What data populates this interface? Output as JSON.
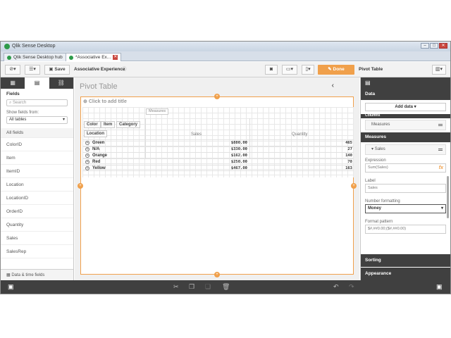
{
  "window": {
    "title": "Qlik Sense Desktop"
  },
  "tabs": [
    {
      "label": "Qlik Sense Desktop hub"
    },
    {
      "label": "*Associative Ex..."
    }
  ],
  "toolbar": {
    "save_label": "Save",
    "app_name": "Associative Experience",
    "done_label": "Done",
    "viz_name": "Pivot Table"
  },
  "left_panel": {
    "title": "Fields",
    "search_placeholder": "Search",
    "show_fields_label": "Show fields from:",
    "tables_select": "All tables",
    "all_fields": "All fields",
    "fields": [
      "ColorID",
      "Item",
      "ItemID",
      "Location",
      "LocationID",
      "OrderID",
      "Quantity",
      "Sales",
      "SalesRep"
    ],
    "footer": "Data & time fields"
  },
  "sheet": {
    "title": "Pivot Table",
    "object_title": "Click to add title",
    "measures_chip": "Measures",
    "dims": [
      "Color",
      "Item",
      "Category",
      "Location"
    ],
    "col_sales": "Sales",
    "col_quantity": "Quantity",
    "rows": [
      {
        "label": "Green",
        "sales": "$880.00",
        "quantity": "465"
      },
      {
        "label": "N/A",
        "sales": "$330.00",
        "quantity": "27"
      },
      {
        "label": "Orange",
        "sales": "$162.00",
        "quantity": "140"
      },
      {
        "label": "Red",
        "sales": "$250.00",
        "quantity": "78"
      },
      {
        "label": "Yellow",
        "sales": "$467.00",
        "quantity": "163"
      }
    ]
  },
  "right_panel": {
    "data_header": "Data",
    "add_data": "Add data ▾",
    "columns_label": "Columns",
    "measures_item": "Measures",
    "measures_header": "Measures",
    "sales_item": "Sales",
    "expression_label": "Expression",
    "expression_value": "Sum(Sales)",
    "label_label": "Label",
    "label_value": "Sales",
    "number_formatting_label": "Number formatting",
    "number_formatting_value": "Money",
    "format_pattern_label": "Format pattern",
    "format_pattern_value": "$#,##0.00;($#,##0.00)",
    "sorting": "Sorting",
    "appearance": "Appearance"
  },
  "colors": {
    "accent": "#f0a04b",
    "dark": "#404040"
  }
}
